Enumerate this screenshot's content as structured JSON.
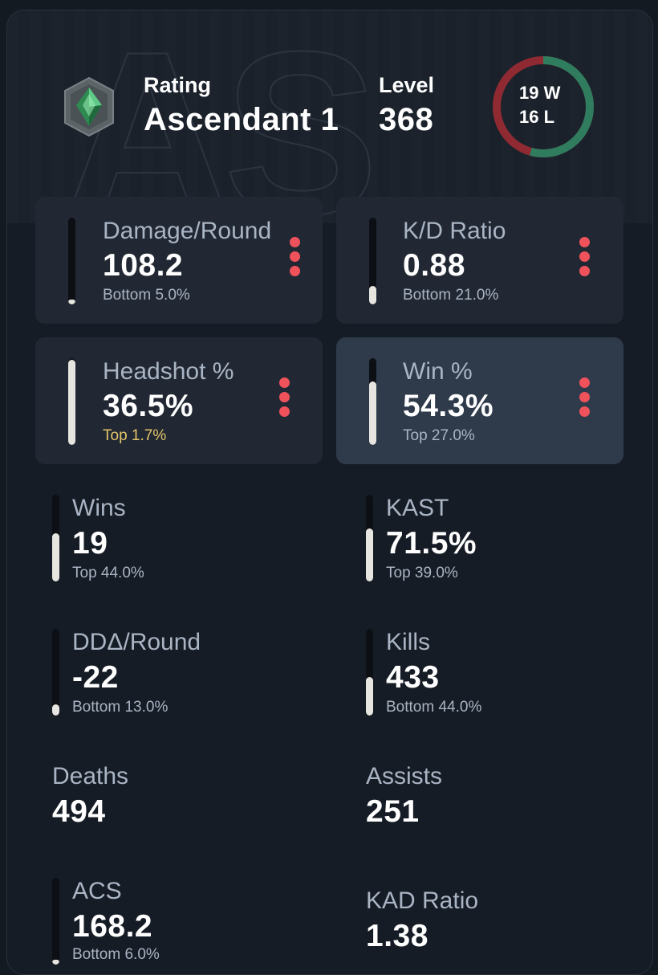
{
  "colors": {
    "background": "#141a22",
    "card": "#222833",
    "card_active": "#2f3b4b",
    "label": "#a9b4c4",
    "accent_red": "#f0525b",
    "win_green": "#2f7d5e",
    "loss_red": "#8f2a33",
    "top_gold": "#e3c56b"
  },
  "header": {
    "watermark": "AS",
    "rank_icon": "ascendant-rank-icon",
    "rating_label": "Rating",
    "rating_value": "Ascendant 1",
    "level_label": "Level",
    "level_value": "368",
    "wins_text": "19 W",
    "losses_text": "16 L",
    "wins": 19,
    "losses": 16
  },
  "cards": [
    {
      "label": "Damage/Round",
      "value": "108.2",
      "rank": "Bottom 5.0%",
      "fill": 0.05,
      "rank_style": "normal",
      "active": false
    },
    {
      "label": "K/D Ratio",
      "value": "0.88",
      "rank": "Bottom 21.0%",
      "fill": 0.21,
      "rank_style": "normal",
      "active": false
    },
    {
      "label": "Headshot %",
      "value": "36.5%",
      "rank": "Top 1.7%",
      "fill": 0.98,
      "rank_style": "gold",
      "active": false
    },
    {
      "label": "Win %",
      "value": "54.3%",
      "rank": "Top 27.0%",
      "fill": 0.73,
      "rank_style": "normal",
      "active": true
    }
  ],
  "stats": [
    {
      "label": "Wins",
      "value": "19",
      "rank": "Top 44.0%",
      "fill": 0.56,
      "has_bar": true
    },
    {
      "label": "KAST",
      "value": "71.5%",
      "rank": "Top 39.0%",
      "fill": 0.61,
      "has_bar": true
    },
    {
      "label": "DDΔ/Round",
      "value": "-22",
      "rank": "Bottom 13.0%",
      "fill": 0.13,
      "has_bar": true
    },
    {
      "label": "Kills",
      "value": "433",
      "rank": "Bottom 44.0%",
      "fill": 0.44,
      "has_bar": true
    },
    {
      "label": "Deaths",
      "value": "494",
      "rank": "",
      "fill": 0,
      "has_bar": false
    },
    {
      "label": "Assists",
      "value": "251",
      "rank": "",
      "fill": 0,
      "has_bar": false
    },
    {
      "label": "ACS",
      "value": "168.2",
      "rank": "Bottom 6.0%",
      "fill": 0.06,
      "has_bar": true
    },
    {
      "label": "KAD Ratio",
      "value": "1.38",
      "rank": "",
      "fill": 0,
      "has_bar": false
    }
  ]
}
